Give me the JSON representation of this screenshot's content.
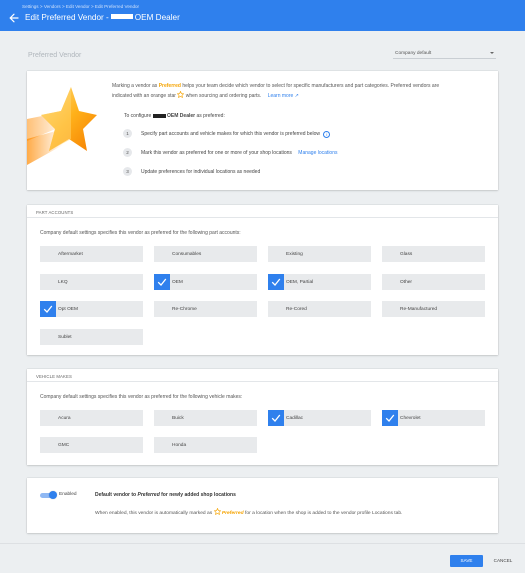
{
  "header": {
    "breadcrumb": "Settings > Vendors > Edit Vendor > Edit Preferred Vendor",
    "title_prefix": "Edit Preferred Vendor -",
    "title_suffix": "OEM Dealer"
  },
  "preferred_vendor": {
    "title": "Preferred Vendor",
    "scope_select": "Company default"
  },
  "intro": {
    "text_1": "Marking a vendor as",
    "preferred_word": "Preferred",
    "text_2": "helps your team decide which vendor to select for specific manufacturers and part categories. Preferred vendors are",
    "text_3": "indicated with an orange star",
    "text_4": "when sourcing and ordering parts.",
    "learn_more": "Learn more",
    "configure_prefix": "To configure",
    "configure_vendor": "OEM Dealer",
    "configure_suffix": "as preferred:",
    "steps": [
      {
        "n": "1",
        "text": "Specify part accounts and vehicle makes for which this vendor is preferred below"
      },
      {
        "n": "2",
        "text": "Mark this vendor as preferred for one or more of your shop locations",
        "link": "Manage locations"
      },
      {
        "n": "3",
        "text": "Update preferences for individual locations as needed"
      }
    ]
  },
  "part_accounts": {
    "header": "PART ACCOUNTS",
    "description": "Company default settings specifies this vendor as preferred for the following part accounts:",
    "items": [
      {
        "label": "Aftermarket",
        "checked": false
      },
      {
        "label": "Consumables",
        "checked": false
      },
      {
        "label": "Existing",
        "checked": false
      },
      {
        "label": "Glass",
        "checked": false
      },
      {
        "label": "LKQ",
        "checked": false
      },
      {
        "label": "OEM",
        "checked": true
      },
      {
        "label": "OEM, Partial",
        "checked": true
      },
      {
        "label": "Other",
        "checked": false
      },
      {
        "label": "Opt OEM",
        "checked": true
      },
      {
        "label": "Re-Chrome",
        "checked": false
      },
      {
        "label": "Re-Cored",
        "checked": false
      },
      {
        "label": "Re-Manufactured",
        "checked": false
      },
      {
        "label": "Sublet",
        "checked": false
      }
    ]
  },
  "vehicle_makes": {
    "header": "VEHICLE MAKES",
    "description": "Company default settings specifies this vendor as preferred for the following vehicle makes:",
    "items": [
      {
        "label": "Acura",
        "checked": false
      },
      {
        "label": "Buick",
        "checked": false
      },
      {
        "label": "Cadillac",
        "checked": true
      },
      {
        "label": "Chevrolet",
        "checked": true
      },
      {
        "label": "GMC",
        "checked": false
      },
      {
        "label": "Honda",
        "checked": false
      }
    ]
  },
  "default_vendor": {
    "toggle_label": "Enabled",
    "toggle_on": true,
    "title_1": "Default vendor to",
    "title_preferred": "Preferred",
    "title_2": "for newly added shop locations",
    "desc_1": "When enabled, this vendor is automatically marked as",
    "desc_preferred": "Preferred",
    "desc_2": "for a location when the shop is added to the vendor profile Locations tab."
  },
  "footer": {
    "save": "SAVE",
    "cancel": "CANCEL"
  },
  "colors": {
    "primary": "#2f80ed",
    "preferred_orange": "#f5a300"
  }
}
